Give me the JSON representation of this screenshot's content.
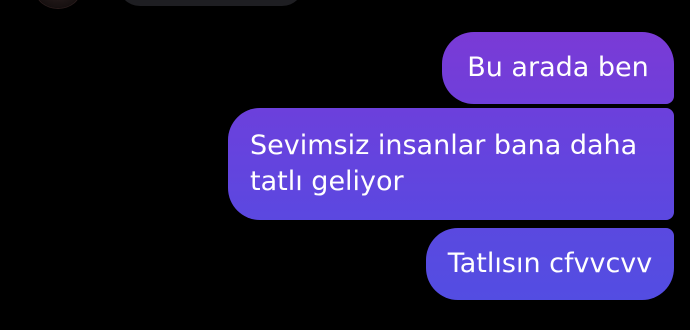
{
  "messages": {
    "outgoing": [
      {
        "text": "Bu arada ben"
      },
      {
        "lines": [
          "Sevimsiz insanlar bana daha",
          "tatlı geliyor"
        ]
      },
      {
        "text": "Tatlısın cfvvcvv"
      }
    ]
  },
  "colors": {
    "background": "#000000",
    "bubble_top": "#7a3ad6",
    "bubble_bottom": "#534de2",
    "incoming_bubble": "#1e1e22"
  }
}
